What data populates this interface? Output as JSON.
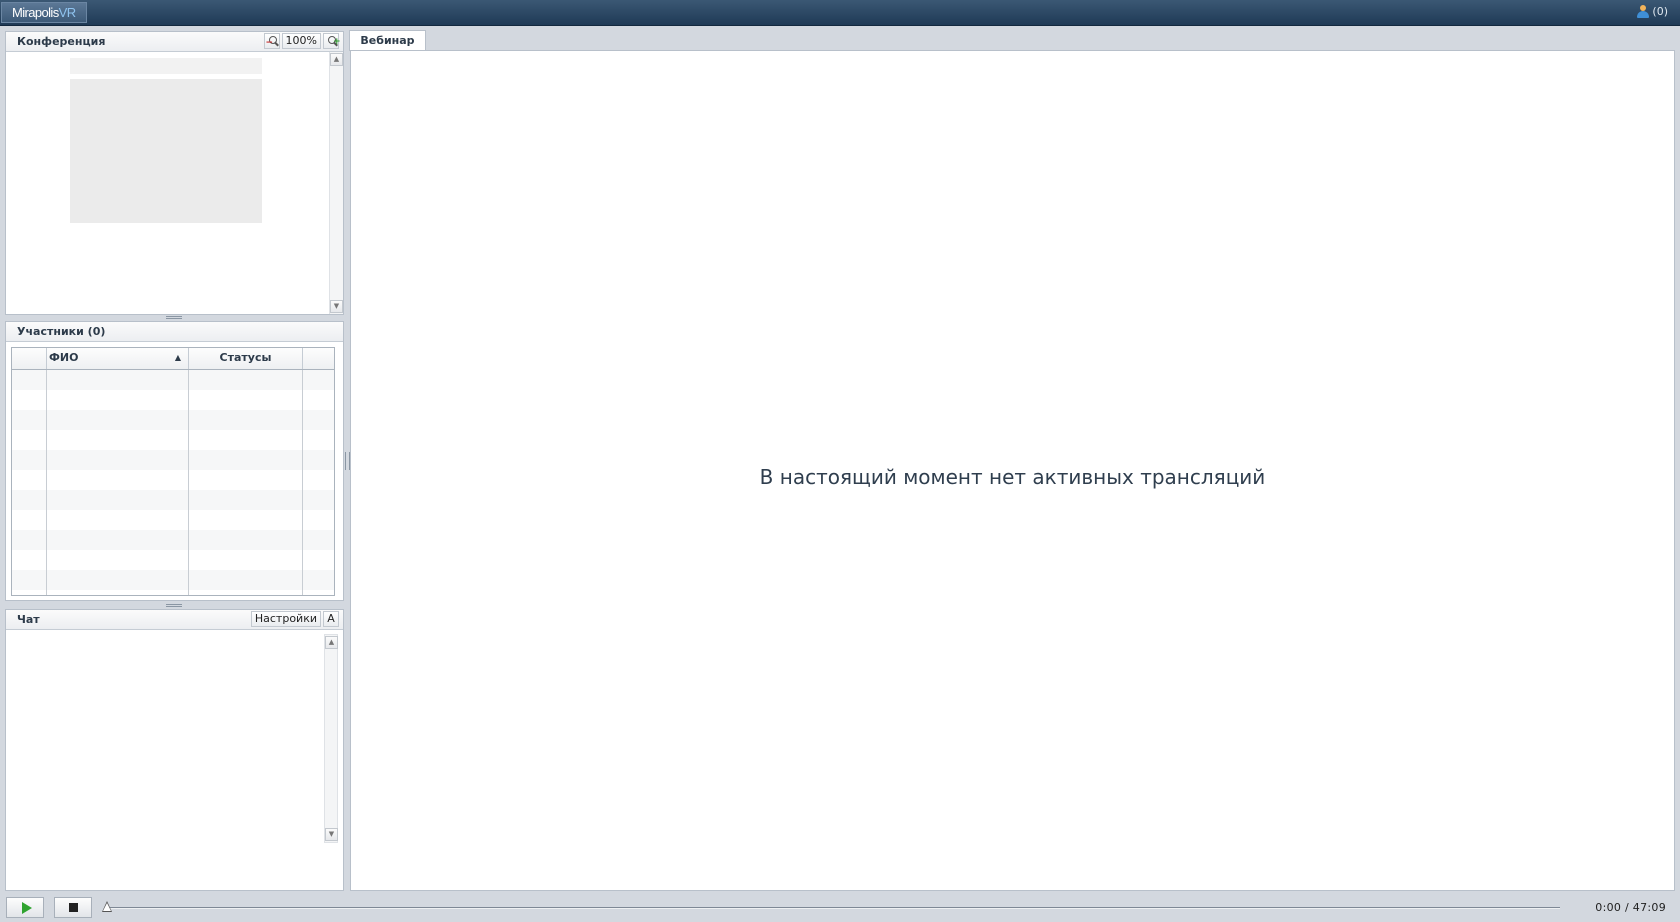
{
  "app": {
    "logo_part1": "Mirapolis",
    "logo_part2": "VR",
    "user_count": "(0)"
  },
  "conference": {
    "title": "Конференция",
    "zoom_level": "100%"
  },
  "participants": {
    "title": "Участники (0)",
    "columns": [
      "",
      "ФИО",
      "Статусы",
      ""
    ],
    "sort_indicator": "▲"
  },
  "chat": {
    "title": "Чат",
    "settings_label": "Настройки",
    "font_label": "A"
  },
  "webinar": {
    "tab_label": "Вебинар",
    "empty_message": "В настоящий момент нет активных трансляций"
  },
  "player": {
    "current_time": "0:00",
    "separator": "/",
    "total_time": "47:09",
    "progress": 0
  }
}
